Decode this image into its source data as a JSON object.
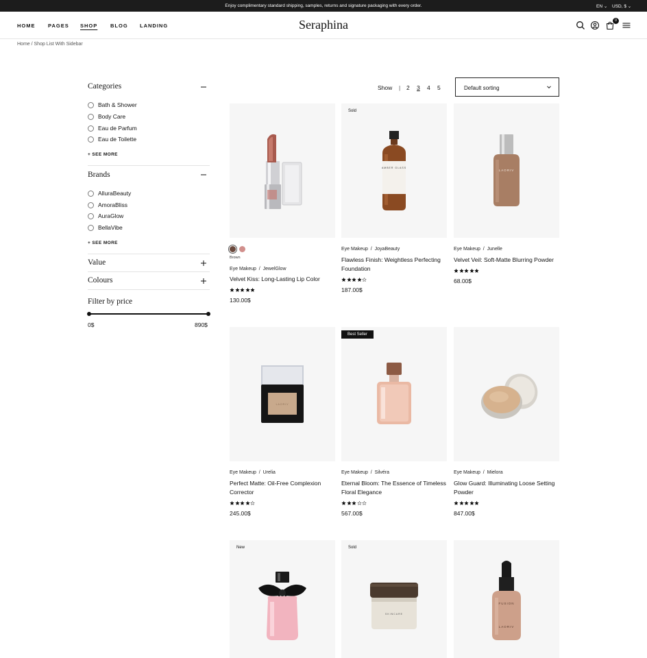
{
  "topbar": {
    "message": "Enjoy complimentary standard shipping, samples, returns and signature packaging with every order.",
    "language": "EN",
    "currency": "USD, $"
  },
  "header": {
    "nav": [
      "HOME",
      "PAGES",
      "SHOP",
      "BLOG",
      "LANDING"
    ],
    "active_nav": "SHOP",
    "logo": "Seraphina",
    "cart_count": "0"
  },
  "breadcrumb": "Home / Shop List With Sidebar",
  "sidebar": {
    "categories": {
      "title": "Categories",
      "items": [
        "Bath & Shower",
        "Body Care",
        "Eau de Parfum",
        "Eau de Toilette"
      ],
      "see_more": "+ SEE MORE"
    },
    "brands": {
      "title": "Brands",
      "items": [
        "AlluraBeauty",
        "AmoraBliss",
        "AuraGlow",
        "BellaVibe"
      ],
      "see_more": "+ SEE MORE"
    },
    "value": {
      "title": "Value"
    },
    "colours": {
      "title": "Colours"
    },
    "price": {
      "title": "Filter by price",
      "min": "0$",
      "max": "890$"
    }
  },
  "toolbar": {
    "show_label": "Show",
    "separator": "|",
    "counts": [
      "2",
      "3",
      "4",
      "5"
    ],
    "active_count": "3",
    "sort_label": "Default sorting"
  },
  "colors": {
    "dark": "#111111",
    "placeholder_bg": "#f6f6f6"
  },
  "products": [
    {
      "badge": "",
      "category": "Eye Makeup",
      "brand": "JewelGlow",
      "name": "Velvet Kiss: Long-Lasting Lip Color",
      "rating": 5,
      "price": "130.00$",
      "swatch_label": "Brown",
      "swatches": [
        "#6b4a3e",
        "#d18f8c"
      ]
    },
    {
      "badge": "Sold",
      "category": "Eye Makeup",
      "brand": "JoyaBeauty",
      "name": "Flawless Finish: Weightless Perfecting Foundation",
      "rating": 4,
      "price": "187.00$"
    },
    {
      "badge": "",
      "category": "Eye Makeup",
      "brand": "Junelle",
      "name": "Velvet Veil: Soft-Matte Blurring Powder",
      "rating": 5,
      "price": "68.00$"
    },
    {
      "badge": "",
      "category": "Eye Makeup",
      "brand": "Urelia",
      "name": "Perfect Matte: Oil-Free Complexion Corrector",
      "rating": 4,
      "price": "245.00$"
    },
    {
      "badge": "Best Seller",
      "category": "Eye Makeup",
      "brand": "Silvéra",
      "name": "Eternal Bloom: The Essence of Timeless Floral Elegance",
      "rating": 3,
      "price": "567.00$"
    },
    {
      "badge": "",
      "category": "Eye Makeup",
      "brand": "Mielora",
      "name": "Glow Guard: Illuminating Loose Setting Powder",
      "rating": 5,
      "price": "847.00$"
    },
    {
      "badge": "New",
      "category": "",
      "brand": "",
      "name": "",
      "rating": 0,
      "price": ""
    },
    {
      "badge": "Sold",
      "category": "",
      "brand": "",
      "name": "",
      "rating": 0,
      "price": ""
    },
    {
      "badge": "",
      "category": "",
      "brand": "",
      "name": "",
      "rating": 0,
      "price": ""
    }
  ],
  "product_labels": {
    "p2": "AMBER GLASS",
    "p3": "LAORIV",
    "p4": "LAORIV",
    "p8": "SKINCARE",
    "p9_top": "FUSION",
    "p9_bottom": "LAORIV"
  }
}
